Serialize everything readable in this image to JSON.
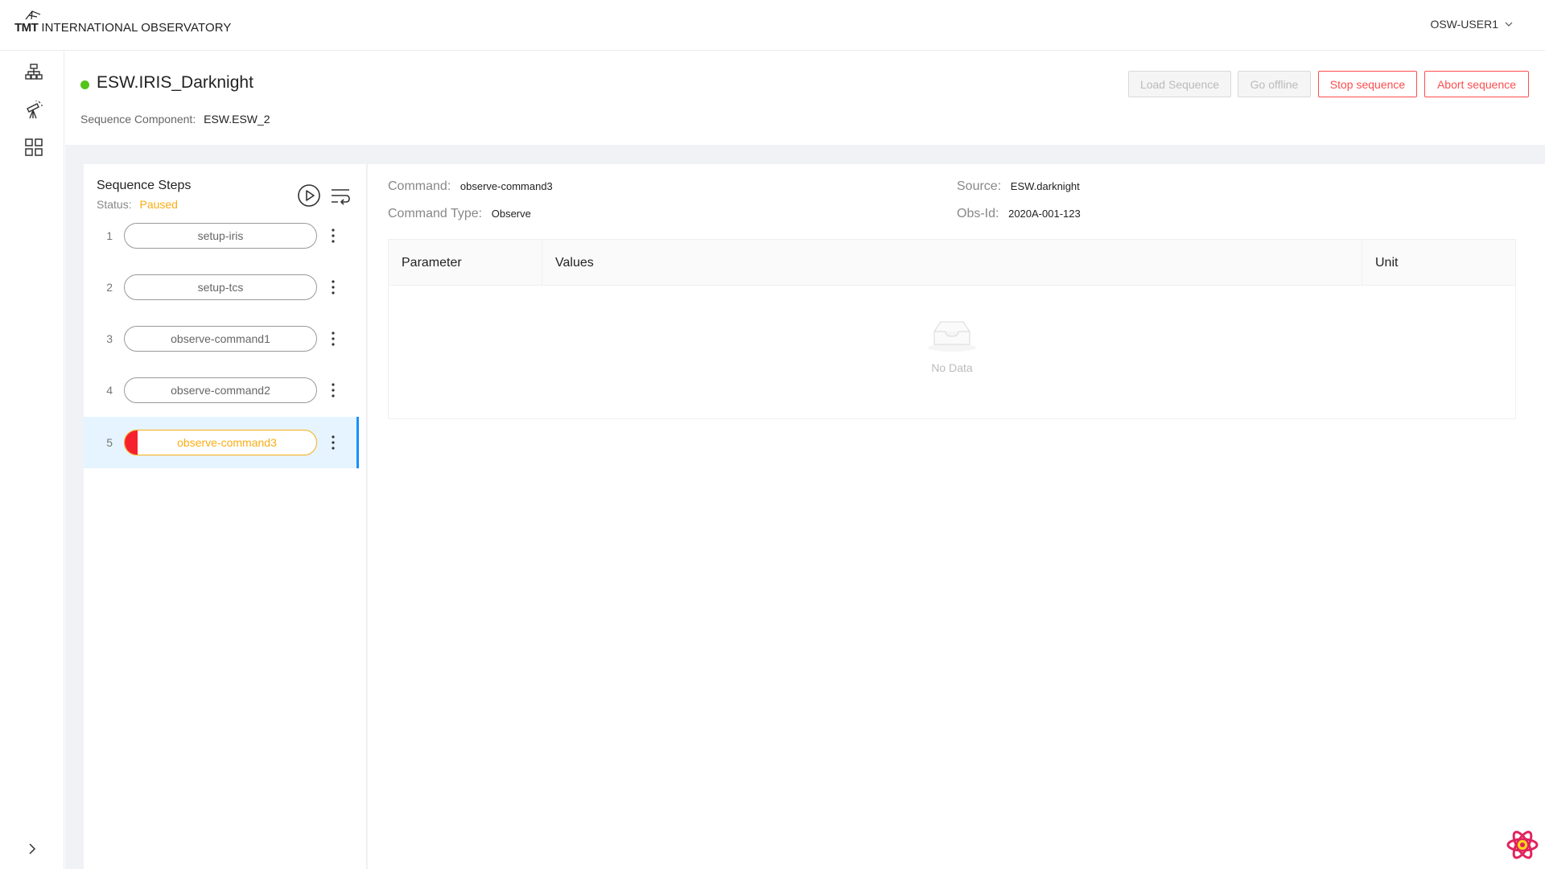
{
  "header": {
    "logo_mark": "TMT",
    "logo_text": "INTERNATIONAL OBSERVATORY",
    "user": "OSW-USER1"
  },
  "sidebar": {
    "icons": [
      "sitemap-icon",
      "telescope-icon",
      "grid-icon"
    ],
    "expand_icon": "chevron-right-icon"
  },
  "sequencer": {
    "title": "ESW.IRIS_Darknight",
    "status_color": "#52c41a",
    "component_label": "Sequence Component:",
    "component_value": "ESW.ESW_2"
  },
  "actions": {
    "load": "Load Sequence",
    "offline": "Go offline",
    "stop": "Stop sequence",
    "abort": "Abort sequence"
  },
  "steps_panel": {
    "title": "Sequence Steps",
    "status_label": "Status:",
    "status_value": "Paused",
    "steps": [
      {
        "num": "1",
        "label": "setup-iris"
      },
      {
        "num": "2",
        "label": "setup-tcs"
      },
      {
        "num": "3",
        "label": "observe-command1"
      },
      {
        "num": "4",
        "label": "observe-command2"
      },
      {
        "num": "5",
        "label": "observe-command3"
      }
    ]
  },
  "details": {
    "command_label": "Command",
    "command_value": "observe-command3",
    "command_type_label": "Command Type",
    "command_type_value": "Observe",
    "source_label": "Source",
    "source_value": "ESW.darknight",
    "obsid_label": "Obs-Id",
    "obsid_value": "2020A-001-123"
  },
  "params_table": {
    "columns": [
      "Parameter",
      "Values",
      "Unit"
    ],
    "empty_text": "No Data"
  },
  "colors": {
    "accent": "#1890ff",
    "danger": "#ff4d4f",
    "paused": "#faad14",
    "online": "#52c41a"
  }
}
